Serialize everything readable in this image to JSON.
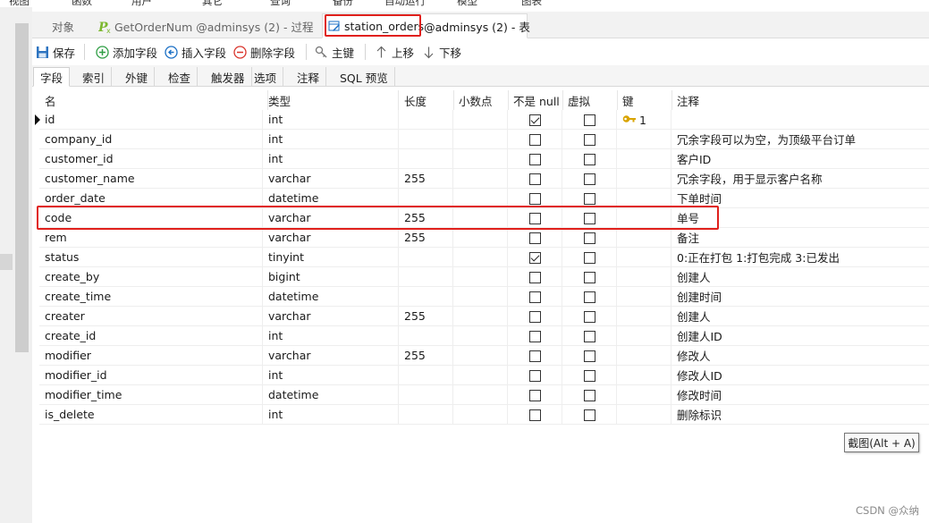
{
  "menu": [
    "视图",
    "函数",
    "用户",
    "其它",
    "查询",
    "备份",
    "自动运行",
    "模型",
    "图表"
  ],
  "tabs": [
    {
      "label": "对象",
      "active": false,
      "icon": "none"
    },
    {
      "label": "GetOrderNum @adminsys (2) - 过程",
      "active": false,
      "icon": "procedure-icon"
    },
    {
      "label": "station_orders",
      "suffix": " @adminsys (2) - 表",
      "active": true,
      "icon": "table-design-icon"
    }
  ],
  "toolbar": {
    "save": "保存",
    "add_field": "添加字段",
    "insert_field": "插入字段",
    "delete_field": "删除字段",
    "primary_key": "主键",
    "move_up": "上移",
    "move_down": "下移"
  },
  "subtabs": [
    "字段",
    "索引",
    "外键",
    "检查",
    "触发器",
    "选项",
    "注释",
    "SQL 预览"
  ],
  "columns": {
    "name": "名",
    "type": "类型",
    "length": "长度",
    "decimals": "小数点",
    "not_null": "不是 null",
    "virtual": "虚拟",
    "key": "键",
    "comment": "注释"
  },
  "rows": [
    {
      "name": "id",
      "type": "int",
      "length": "",
      "not_null": true,
      "virtual": false,
      "key": "1",
      "comment": ""
    },
    {
      "name": "company_id",
      "type": "int",
      "length": "",
      "not_null": false,
      "virtual": false,
      "key": "",
      "comment": "冗余字段可以为空，为顶级平台订单"
    },
    {
      "name": "customer_id",
      "type": "int",
      "length": "",
      "not_null": false,
      "virtual": false,
      "key": "",
      "comment": "客户ID"
    },
    {
      "name": "customer_name",
      "type": "varchar",
      "length": "255",
      "not_null": false,
      "virtual": false,
      "key": "",
      "comment": "冗余字段，用于显示客户名称"
    },
    {
      "name": "order_date",
      "type": "datetime",
      "length": "",
      "not_null": false,
      "virtual": false,
      "key": "",
      "comment": "下单时间"
    },
    {
      "name": "code",
      "type": "varchar",
      "length": "255",
      "not_null": false,
      "virtual": false,
      "key": "",
      "comment": "单号"
    },
    {
      "name": "rem",
      "type": "varchar",
      "length": "255",
      "not_null": false,
      "virtual": false,
      "key": "",
      "comment": "备注"
    },
    {
      "name": "status",
      "type": "tinyint",
      "length": "",
      "not_null": true,
      "virtual": false,
      "key": "",
      "comment": "0:正在打包 1:打包完成 3:已发出"
    },
    {
      "name": "create_by",
      "type": "bigint",
      "length": "",
      "not_null": false,
      "virtual": false,
      "key": "",
      "comment": "创建人"
    },
    {
      "name": "create_time",
      "type": "datetime",
      "length": "",
      "not_null": false,
      "virtual": false,
      "key": "",
      "comment": "创建时间"
    },
    {
      "name": "creater",
      "type": "varchar",
      "length": "255",
      "not_null": false,
      "virtual": false,
      "key": "",
      "comment": "创建人"
    },
    {
      "name": "create_id",
      "type": "int",
      "length": "",
      "not_null": false,
      "virtual": false,
      "key": "",
      "comment": "创建人ID"
    },
    {
      "name": "modifier",
      "type": "varchar",
      "length": "255",
      "not_null": false,
      "virtual": false,
      "key": "",
      "comment": "修改人"
    },
    {
      "name": "modifier_id",
      "type": "int",
      "length": "",
      "not_null": false,
      "virtual": false,
      "key": "",
      "comment": "修改人ID"
    },
    {
      "name": "modifier_time",
      "type": "datetime",
      "length": "",
      "not_null": false,
      "virtual": false,
      "key": "",
      "comment": "修改时间"
    },
    {
      "name": "is_delete",
      "type": "int",
      "length": "",
      "not_null": false,
      "virtual": false,
      "key": "",
      "comment": "删除标识"
    }
  ],
  "tooltip": "截图(Alt + A)",
  "watermark": "CSDN @众纳",
  "colors": {
    "highlight": "#e0201c",
    "accent": "#1a6fc4",
    "key": "#d9a400"
  }
}
